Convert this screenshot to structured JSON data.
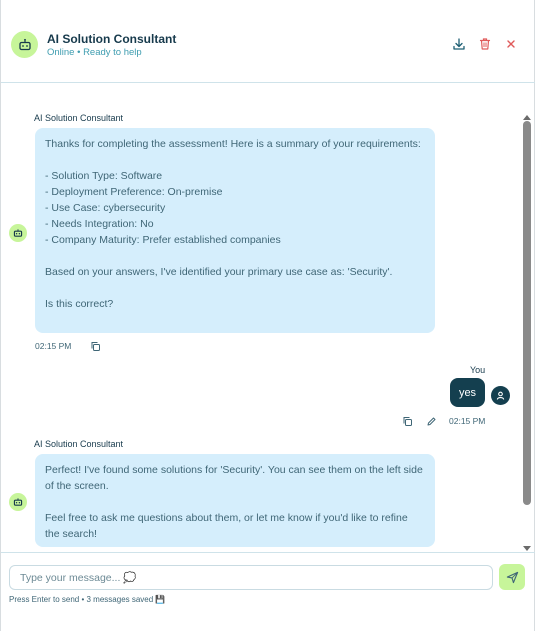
{
  "header": {
    "title": "AI Solution Consultant",
    "status": "Online • Ready to help",
    "icons": [
      "robot-icon",
      "download-icon",
      "trash-icon",
      "close-icon"
    ]
  },
  "messages": [
    {
      "sender": "AI Solution Consultant",
      "text": "Thanks for completing the assessment! Here is a summary of your requirements:\n\n- Solution Type: Software\n- Deployment Preference: On-premise\n- Use Case: cybersecurity\n- Needs Integration: No\n- Company Maturity: Prefer established companies\n\nBased on your answers, I've identified your primary use case as: 'Security'.\n\nIs this correct?",
      "time": "02:15 PM"
    },
    {
      "sender": "You",
      "text": "yes",
      "time": "02:15 PM"
    },
    {
      "sender": "AI Solution Consultant",
      "text": "Perfect! I've found some solutions for 'Security'. You can see them on the left side of the screen.\n\nFeel free to ask me questions about them, or let me know if you'd like to refine the search!"
    }
  ],
  "composer": {
    "placeholder": "Type your message... 💭",
    "hint": "Press Enter to send • 3 messages saved 💾"
  },
  "colors": {
    "accent": "#c7f59a",
    "bot_bubble": "#d5eefc",
    "user_bubble": "#143f4f",
    "status_text": "#3f9db0",
    "delete_icon": "#e05a5a"
  }
}
